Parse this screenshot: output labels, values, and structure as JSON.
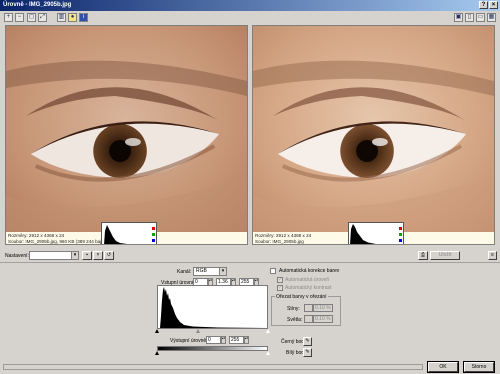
{
  "window": {
    "title": "Úrovně - IMG_2905b.jpg",
    "close": "×",
    "help": "?"
  },
  "toolbar": {
    "tools": [
      "zoom-in-icon",
      "zoom-out-icon",
      "fit-icon",
      "actual-size-icon",
      "split-view-icon",
      "highlight-icon",
      "info-icon"
    ],
    "views": [
      "view-single-icon",
      "view-vertical-icon",
      "view-horizontal-icon",
      "view-quad-icon"
    ]
  },
  "panels": {
    "left": {
      "size": "Rozměry: 2912 x 4368 x 24",
      "file": "Soubor: IMG_2905b.jpg, 960 KB (389 244 bajtů)"
    },
    "right": {
      "size": "Rozměry: 2912 x 4368 x 24",
      "file": "Soubor: IMG_2905b.jpg"
    }
  },
  "preset": {
    "label": "Nastavení:",
    "value": "",
    "apply_label": "Uložit"
  },
  "levels": {
    "channel_label": "Kanál:",
    "channel_value": "RGB",
    "input_label": "Vstupní úrovně:",
    "input_black": "0",
    "input_gamma": "1.36",
    "input_white": "255",
    "output_label": "Výstupní úrovně:",
    "output_black": "0",
    "output_white": "255"
  },
  "auto": {
    "main": "Automatická korekce barev",
    "opt1": "Automatická úroveň",
    "opt2": "Automatický kontrast",
    "group_title": "Ořezat barvy v ořezání",
    "shadows_label": "Stíny:",
    "shadows_value": "0.10 %",
    "highlights_label": "Světla:",
    "highlights_value": "0.10 %",
    "black_point_label": "Černý bod:",
    "white_point_label": "Bílý bod:"
  },
  "footer": {
    "ok": "OK",
    "cancel": "Storno"
  }
}
